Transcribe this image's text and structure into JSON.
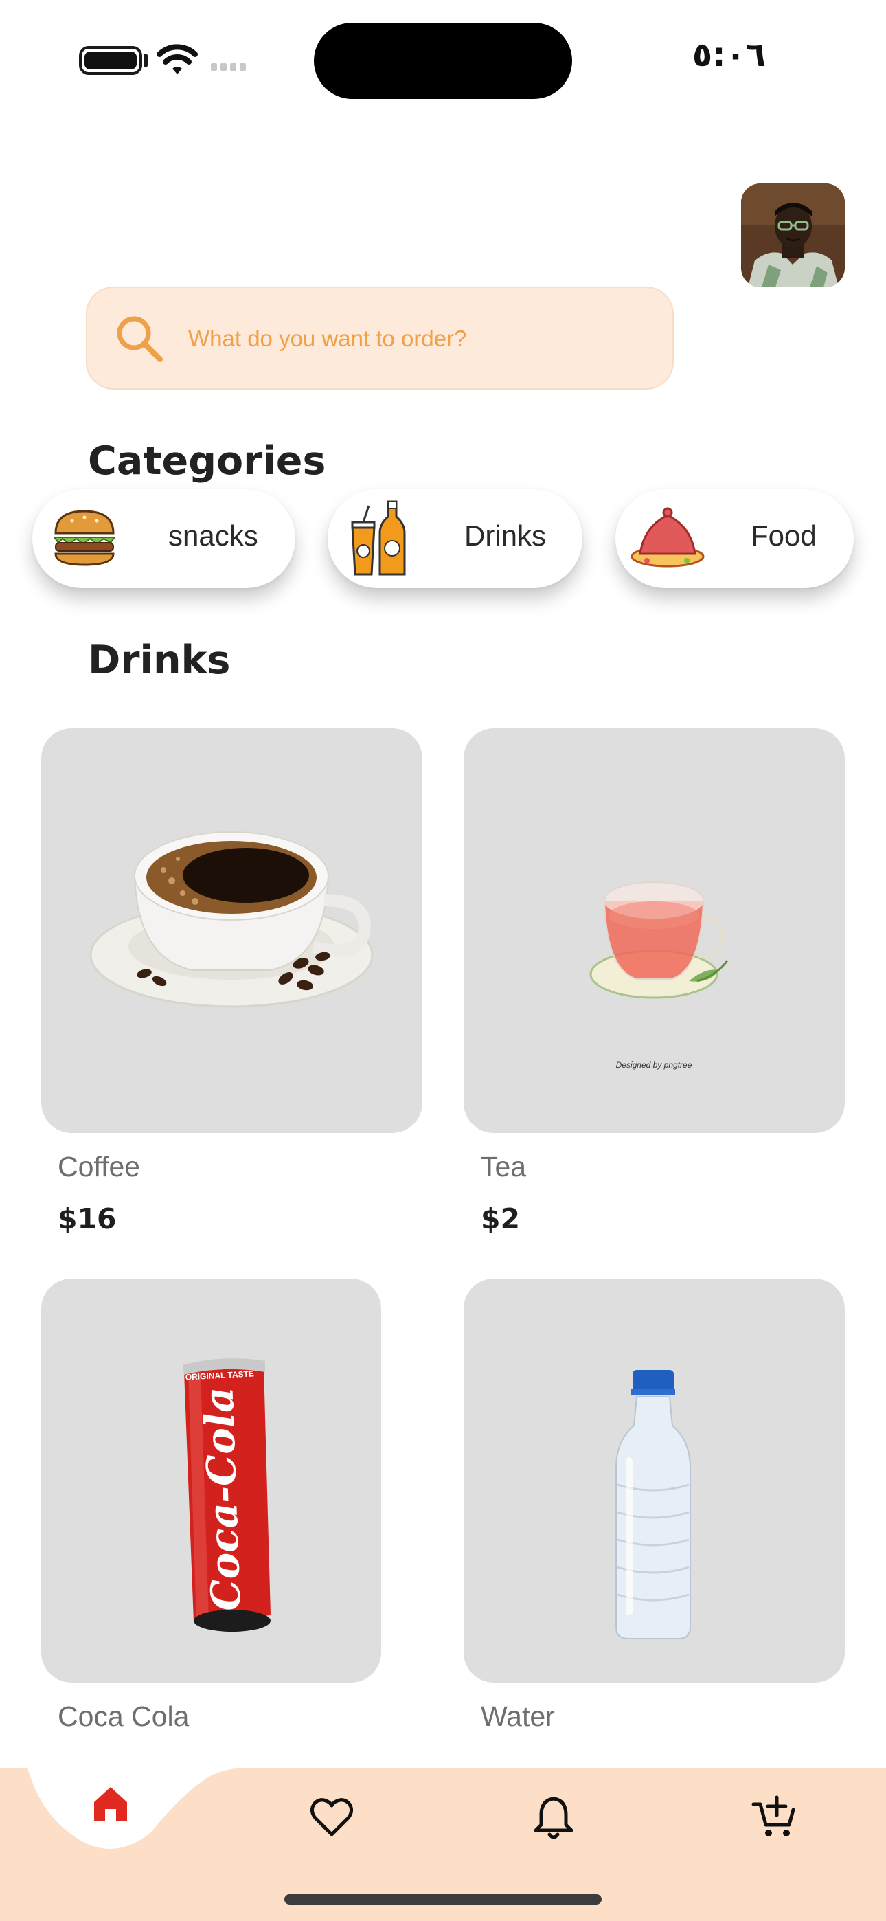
{
  "status_bar": {
    "time": "٥:٠٦"
  },
  "search": {
    "placeholder": "What do you want to order?"
  },
  "categories": {
    "title": "Categories",
    "items": [
      {
        "label": "snacks",
        "icon": "burger-icon"
      },
      {
        "label": "Drinks",
        "icon": "drinks-icon"
      },
      {
        "label": "Food",
        "icon": "tagine-food-icon"
      }
    ]
  },
  "section": {
    "title": "Drinks"
  },
  "products": [
    {
      "name": "Coffee",
      "price": "$16",
      "image": "coffee-cup-image"
    },
    {
      "name": "Tea",
      "price": "$2",
      "image": "tea-cup-image",
      "image_caption": "Designed by pngtree"
    },
    {
      "name": "Coca Cola",
      "image": "coca-cola-can-image",
      "can_text": "Coca-Cola",
      "can_top_text": "ORIGINAL TASTE"
    },
    {
      "name": "Water",
      "image": "water-bottle-image"
    }
  ],
  "bottom_nav": {
    "items": [
      "home-icon",
      "heart-icon",
      "bell-icon",
      "cart-add-icon"
    ],
    "active": "home-icon"
  },
  "colors": {
    "accent": "#f0a046",
    "search_bg": "#fdeadb",
    "nav_bg": "#fcdfc6",
    "active_icon": "#e02a1f",
    "card_bg": "#dedede"
  }
}
